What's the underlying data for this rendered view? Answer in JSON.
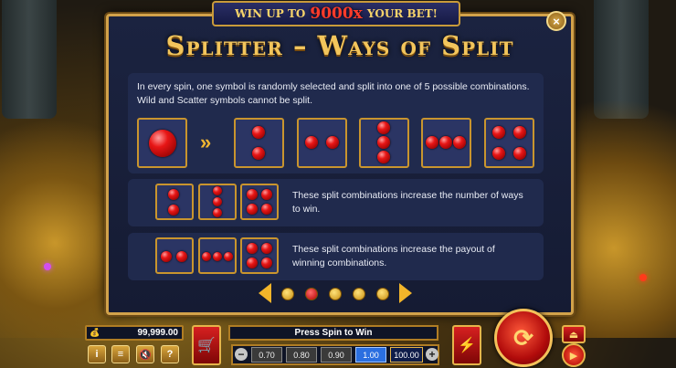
{
  "banner": {
    "prefix": "WIN UP TO",
    "amount": "9000x",
    "suffix": "YOUR BET!"
  },
  "dialog": {
    "title": "Splitter – Ways of Split",
    "description": "In every spin, one symbol is randomly selected and split into one of 5 possible combinations. Wild and Scatter symbols cannot be split.",
    "arrow_glyph": "»",
    "close_glyph": "×",
    "ways_text": "These split combinations increase the number of ways to win.",
    "payout_text": "These split combinations increase the payout of winning combinations.",
    "page_count": 5,
    "active_page": 2
  },
  "bottom_bar": {
    "balance": "99,999.00",
    "balance_icon": "money-bag-icon",
    "status_text": "Press Spin to Win",
    "bet_minus": "−",
    "bet_plus": "+",
    "bet_options": [
      "0.70",
      "0.80",
      "0.90",
      "1.00"
    ],
    "selected_bet": "1.00",
    "total_bet": "100.00",
    "buttons": {
      "info": "i",
      "menu": "≡",
      "sound": "🔇",
      "help": "?"
    }
  },
  "colors": {
    "accent_gold": "#d2a24a",
    "panel_bg": "#1b2340",
    "gem_red": "#e81616",
    "bet_selected": "#2b6fe0"
  }
}
